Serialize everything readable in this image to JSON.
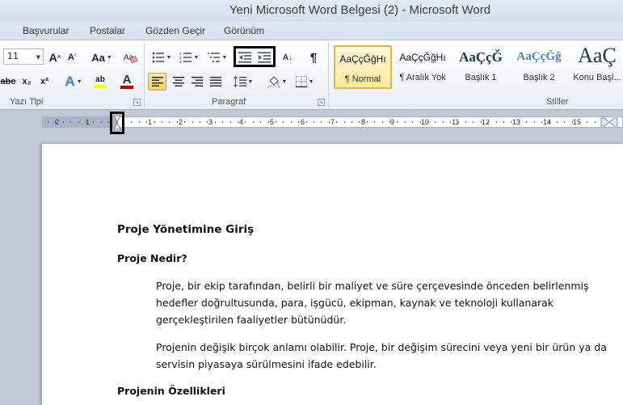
{
  "window": {
    "title": "Yeni Microsoft Word Belgesi (2)  -  Microsoft Word"
  },
  "tabs": [
    "Başvurular",
    "Postalar",
    "Gözden Geçir",
    "Görünüm"
  ],
  "font": {
    "size_value": "11",
    "grow_label": "A",
    "shrink_label": "A",
    "case_label": "Aa",
    "strikethrough_label": "abc",
    "subscript_label": "x₂",
    "superscript_label": "x²",
    "text_effects_label": "A",
    "highlight_label": "ab",
    "font_color_label": "A",
    "group_label": "Yazı Tipi"
  },
  "paragraph": {
    "group_label": "Paragraf",
    "show_marks_label": "¶",
    "sort_label": "A↓"
  },
  "styles": {
    "group_label": "Stiller",
    "items": [
      {
        "preview": "AaÇçĞğHı",
        "name": "¶ Normal"
      },
      {
        "preview": "AaÇçĞğHı",
        "name": "¶ Aralık Yok"
      },
      {
        "preview": "AaÇçĞ",
        "name": "Başlık 1"
      },
      {
        "preview": "AaÇçĞğ",
        "name": "Başlık 2"
      },
      {
        "preview": "AaÇ",
        "name": "Konu Başl..."
      }
    ]
  },
  "ruler": {
    "numbers": [
      "2",
      "1",
      "1",
      "2",
      "3",
      "4",
      "5",
      "6",
      "7",
      "8",
      "9",
      "10",
      "11",
      "12",
      "13",
      "14",
      "15"
    ]
  },
  "document": {
    "title": "Proje Yönetimine Giriş",
    "h_what": "Proje Nedir?",
    "p1_l1": "Proje, bir ekip tarafından, belirli bir maliyet ve süre çerçevesinde önceden belirlenmiş",
    "p1_l2": "hedefler doğrultusunda, para, işgücü, ekipman, kaynak ve teknoloji kullanarak",
    "p1_l3": "gerçekleştirilen faaliyetler bütünüdür.",
    "p2_l1": "Projenin değişik birçok anlamı olabilir.  Proje, bir değişim sürecini veya yeni bir ürün ya da",
    "p2_l2": "servisin piyasaya sürülmesini ifade edebilir.",
    "h_features": "Projenin Özellikleri"
  },
  "colors": {
    "accent_pressed": "#f8cf62",
    "font_color_bar": "#c00000",
    "highlight_bar": "#ffff00",
    "heading_blue": "#17365d"
  }
}
